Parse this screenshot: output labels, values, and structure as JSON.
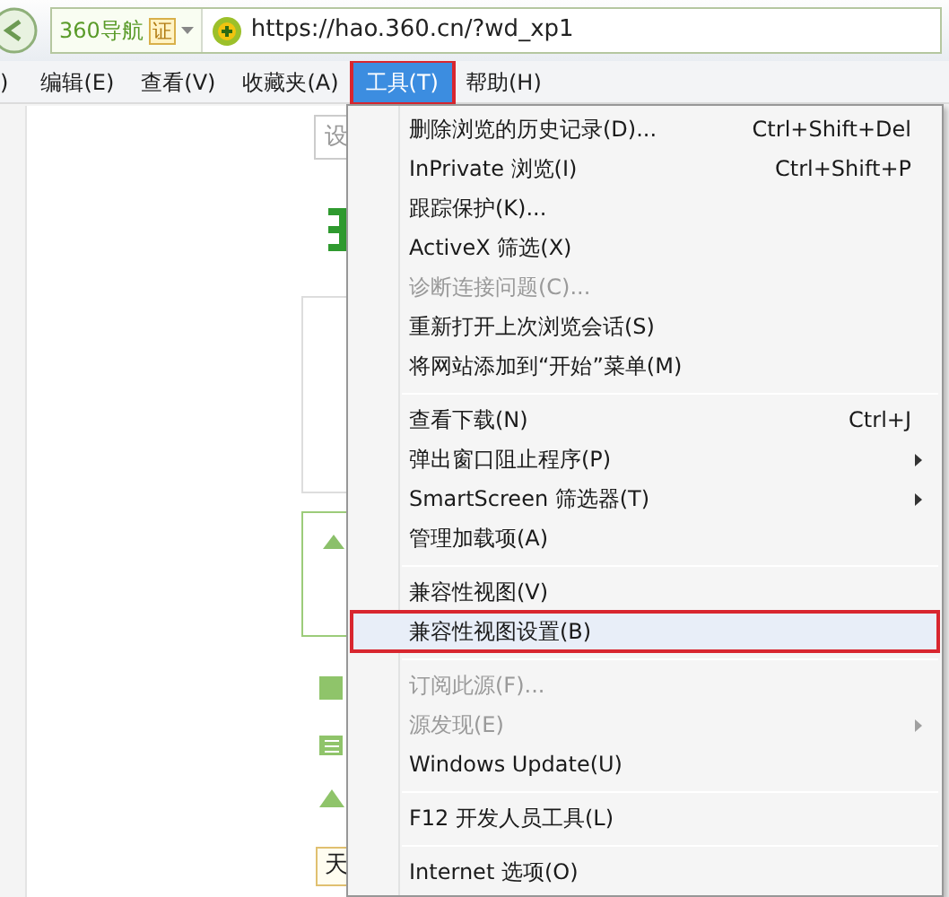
{
  "address_bar": {
    "site_label": "360导航",
    "badge": "证",
    "url": "https://hao.360.cn/?wd_xp1"
  },
  "menu_bar": [
    {
      "label": ")",
      "selected": false
    },
    {
      "label": "编辑(E)",
      "selected": false
    },
    {
      "label": "查看(V)",
      "selected": false
    },
    {
      "label": "收藏夹(A)",
      "selected": false
    },
    {
      "label": "工具(T)",
      "selected": true
    },
    {
      "label": "帮助(H)",
      "selected": false
    }
  ],
  "page": {
    "button_text": "设",
    "field_text": "天"
  },
  "tools_menu": [
    {
      "kind": "item",
      "label": "删除浏览的历史记录(D)...",
      "shortcut": "Ctrl+Shift+Del",
      "disabled": false,
      "submenu": false,
      "selected": false
    },
    {
      "kind": "item",
      "label": "InPrivate 浏览(I)",
      "shortcut": "Ctrl+Shift+P",
      "disabled": false,
      "submenu": false,
      "selected": false
    },
    {
      "kind": "item",
      "label": "跟踪保护(K)...",
      "disabled": false,
      "submenu": false,
      "selected": false
    },
    {
      "kind": "item",
      "label": "ActiveX 筛选(X)",
      "disabled": false,
      "submenu": false,
      "selected": false
    },
    {
      "kind": "item",
      "label": "诊断连接问题(C)...",
      "disabled": true,
      "submenu": false,
      "selected": false
    },
    {
      "kind": "item",
      "label": "重新打开上次浏览会话(S)",
      "disabled": false,
      "submenu": false,
      "selected": false
    },
    {
      "kind": "item",
      "label": "将网站添加到“开始”菜单(M)",
      "disabled": false,
      "submenu": false,
      "selected": false
    },
    {
      "kind": "separator"
    },
    {
      "kind": "item",
      "label": "查看下载(N)",
      "shortcut": "Ctrl+J",
      "disabled": false,
      "submenu": false,
      "selected": false
    },
    {
      "kind": "item",
      "label": "弹出窗口阻止程序(P)",
      "disabled": false,
      "submenu": true,
      "selected": false
    },
    {
      "kind": "item",
      "label": "SmartScreen 筛选器(T)",
      "disabled": false,
      "submenu": true,
      "selected": false
    },
    {
      "kind": "item",
      "label": "管理加载项(A)",
      "disabled": false,
      "submenu": false,
      "selected": false
    },
    {
      "kind": "separator"
    },
    {
      "kind": "item",
      "label": "兼容性视图(V)",
      "disabled": false,
      "submenu": false,
      "selected": false
    },
    {
      "kind": "item",
      "label": "兼容性视图设置(B)",
      "disabled": false,
      "submenu": false,
      "selected": true
    },
    {
      "kind": "separator"
    },
    {
      "kind": "item",
      "label": "订阅此源(F)...",
      "disabled": true,
      "submenu": false,
      "selected": false
    },
    {
      "kind": "item",
      "label": "源发现(E)",
      "disabled": true,
      "submenu": true,
      "selected": false
    },
    {
      "kind": "item",
      "label": "Windows Update(U)",
      "disabled": false,
      "submenu": false,
      "selected": false
    },
    {
      "kind": "separator"
    },
    {
      "kind": "item",
      "label": "F12 开发人员工具(L)",
      "disabled": false,
      "submenu": false,
      "selected": false
    },
    {
      "kind": "separator"
    },
    {
      "kind": "item",
      "label": "Internet 选项(O)",
      "disabled": false,
      "submenu": false,
      "selected": false
    }
  ]
}
